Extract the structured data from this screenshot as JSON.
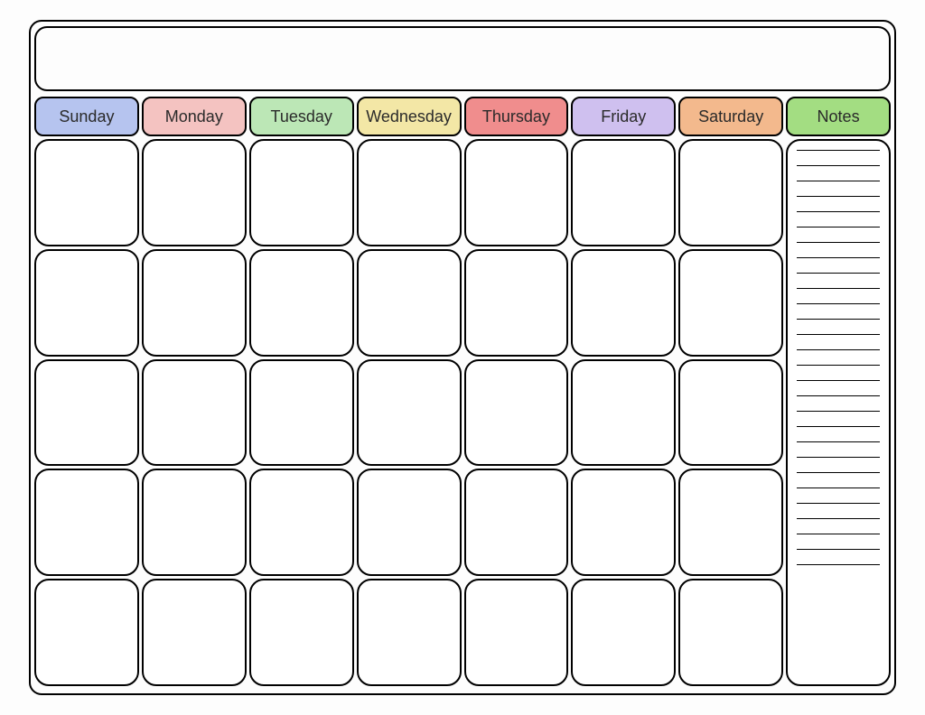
{
  "header": {
    "days": [
      "Sunday",
      "Monday",
      "Tuesday",
      "Wednesday",
      "Thursday",
      "Friday",
      "Saturday"
    ],
    "notes_label": "Notes",
    "colors": {
      "Sunday": "#b6c4ef",
      "Monday": "#f4c3c1",
      "Tuesday": "#bce7b6",
      "Wednesday": "#f3e7a6",
      "Thursday": "#f08d8d",
      "Friday": "#cfc0ef",
      "Saturday": "#f3b98d",
      "Notes": "#a3dd82"
    }
  },
  "grid": {
    "rows": 5,
    "cols": 7
  },
  "notes": {
    "line_count": 28
  }
}
